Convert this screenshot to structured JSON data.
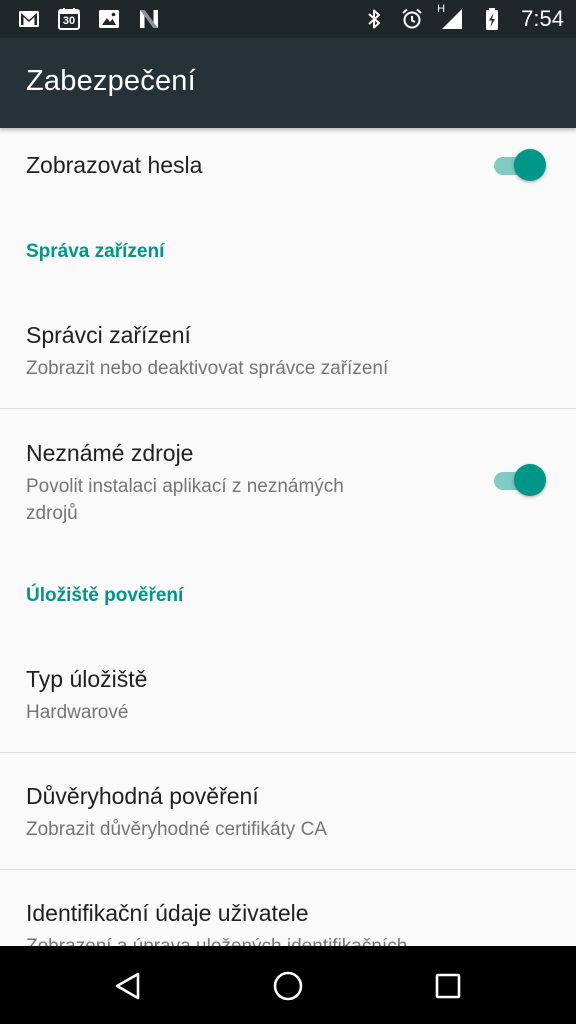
{
  "status_bar": {
    "time": "7:54",
    "calendar_day": "30",
    "network_label": "H",
    "left_icons": [
      "gmail-icon",
      "calendar-icon",
      "photos-icon",
      "n-app-icon"
    ],
    "right_icons": [
      "bluetooth-icon",
      "alarm-icon",
      "signal-icon",
      "battery-charging-icon"
    ]
  },
  "app_bar": {
    "title": "Zabezpečení"
  },
  "settings": {
    "show_passwords": {
      "title": "Zobrazovat hesla",
      "enabled": true
    },
    "device_admin_section": {
      "header": "Správa zařízení"
    },
    "device_admins": {
      "title": "Správci zařízení",
      "subtitle": "Zobrazit nebo deaktivovat správce zařízení"
    },
    "unknown_sources": {
      "title": "Neznámé zdroje",
      "subtitle_line1": "Povolit instalaci aplikací z neznámých",
      "subtitle_line2": "zdrojů",
      "enabled": true
    },
    "credential_storage_section": {
      "header": "Úložiště pověření"
    },
    "storage_type": {
      "title": "Typ úložiště",
      "subtitle": "Hardwarové"
    },
    "trusted_credentials": {
      "title": "Důvěryhodná pověření",
      "subtitle": "Zobrazit důvěryhodné certifikáty CA"
    },
    "user_credentials": {
      "title": "Identifikační údaje uživatele",
      "subtitle": "Zobrazení a úprava uložených identifikačních"
    }
  },
  "colors": {
    "accent": "#009688",
    "accent_track": "#80cbc4",
    "app_bar": "#263238",
    "status_bar": "#202728"
  },
  "nav_bar": {
    "buttons": [
      "back-icon",
      "home-icon",
      "recents-icon"
    ]
  }
}
